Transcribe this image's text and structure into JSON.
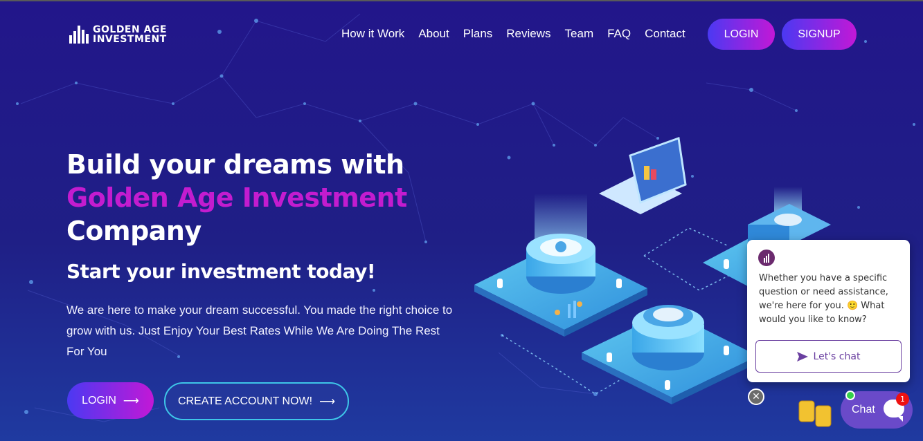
{
  "brand": {
    "line1": "GOLDEN AGE",
    "line2": "INVESTMENT"
  },
  "nav": [
    "How it Work",
    "About",
    "Plans",
    "Reviews",
    "Team",
    "FAQ",
    "Contact"
  ],
  "header_buttons": {
    "login": "LOGIN",
    "signup": "SIGNUP"
  },
  "hero": {
    "line1": "Build your dreams with",
    "line2": "Golden Age Investment",
    "line3": "Company",
    "subtitle": "Start your investment today!",
    "description": "We are here to make your dream successful. You made the right choice to grow with us. Just Enjoy Your Best Rates While We Are Doing The Rest For You",
    "cta_login": "LOGIN",
    "cta_create": "CREATE ACCOUNT NOW!",
    "arrow": "⟶"
  },
  "chat": {
    "message": "Whether you have a specific question or need assistance, we're here for you. 🙂 What would you like to know?",
    "lets_chat": "Let's chat",
    "launcher_label": "Chat",
    "badge_count": "1",
    "close_symbol": "✕"
  },
  "colors": {
    "accent_magenta": "#c31ccf",
    "gradient_start": "#4b39f2",
    "gradient_end": "#c218d6",
    "outline_cyan": "#3ec6e8",
    "chat_purple": "#6a4ac9"
  }
}
